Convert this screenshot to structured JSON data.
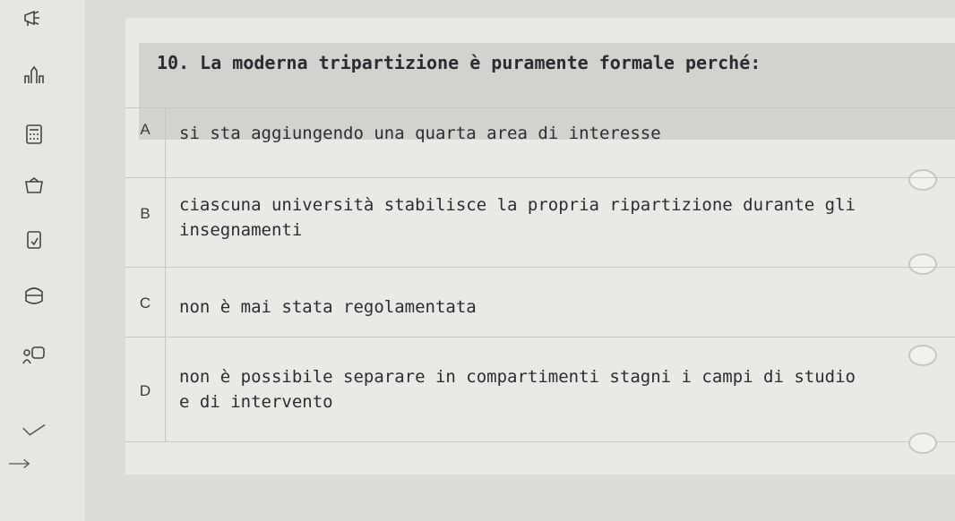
{
  "question": {
    "number": "10.",
    "text": "La moderna tripartizione è puramente formale perché:"
  },
  "options": [
    {
      "letter": "A",
      "text": "si sta aggiungendo una quarta area di interesse"
    },
    {
      "letter": "B",
      "text": "ciascuna università stabilisce la propria ripartizione durante gli insegnamenti"
    },
    {
      "letter": "C",
      "text": "non è mai stata regolamentata"
    },
    {
      "letter": "D",
      "text": "non è possibile separare in compartimenti stagni i campi di studio e di intervento"
    }
  ],
  "sidebar_icons": [
    "megaphone-icon",
    "hands-icon",
    "calculator-icon",
    "bookmark-icon",
    "note-icon",
    "book-icon",
    "person-chat-icon",
    "check-icon",
    "arrow-right-icon"
  ],
  "colors": {
    "background": "#dcdcd7",
    "panel": "#e9e9e6",
    "header": "#d2d2ce",
    "text": "#2d2d31"
  }
}
